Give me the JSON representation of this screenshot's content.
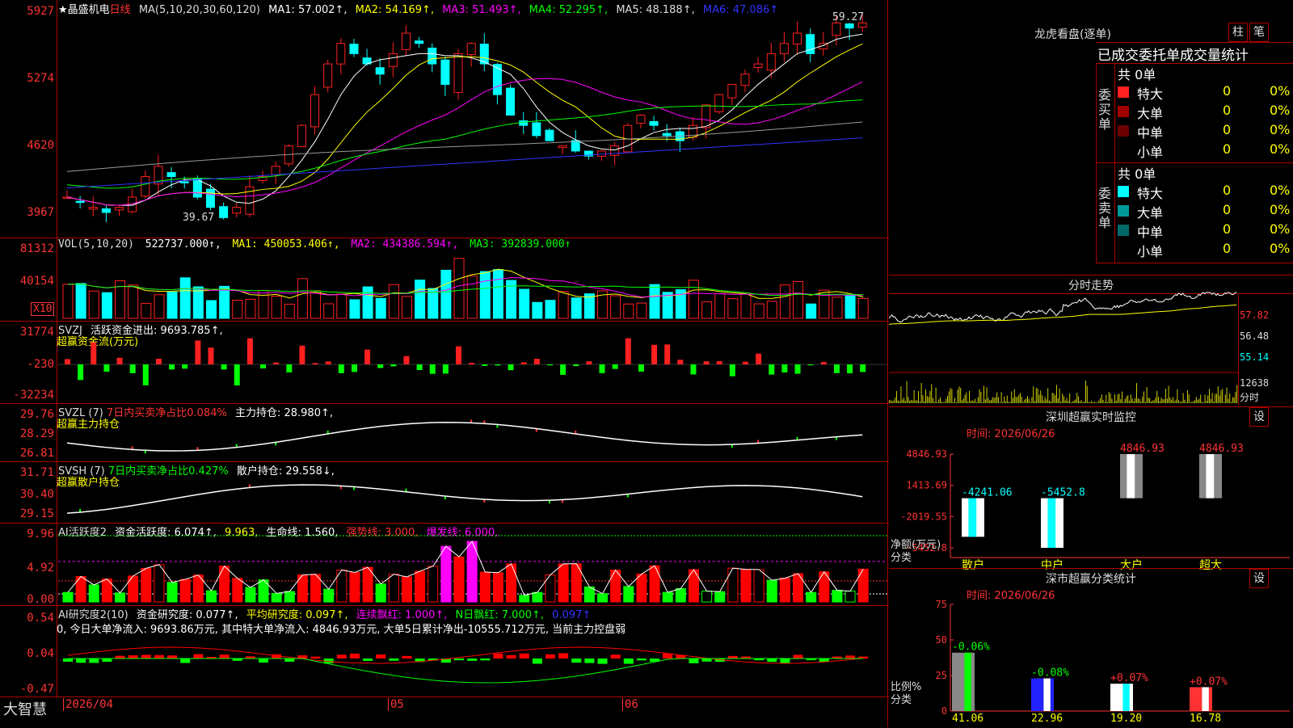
{
  "panels": {
    "price": {
      "header": [
        "★晶盛机电",
        "日线",
        "MA(5,10,20,30,60,120)",
        "MA1: 57.002↑,",
        "MA2: 54.169↑,",
        "MA3: 51.493↑,",
        "MA4: 52.295↑,",
        "MA5: 48.188↑,",
        "MA6: 47.086↑"
      ],
      "axis": [
        "5927",
        "5274",
        "4620",
        "3967"
      ],
      "high_label": "59.27",
      "low_label": "39.67"
    },
    "vol": {
      "header": [
        "VOL(5,10,20)",
        "522737.000↑,",
        "MA1: 450053.406↑,",
        "MA2: 434386.594↑,",
        "MA3: 392839.000↑"
      ],
      "axis": [
        "81312",
        "40154"
      ],
      "unit": "X10"
    },
    "svzj": {
      "header": [
        "SVZJ",
        "活跃资金进出: 9693.785↑,"
      ],
      "sub": "超赢资金流(万元)",
      "axis": [
        "31774",
        "-230",
        "-32234"
      ]
    },
    "svzl": {
      "header": [
        "SVZL (7)",
        "7日内买卖净占比0.084%",
        "主力持仓: 28.980↑,"
      ],
      "sub": "超赢主力持仓",
      "axis": [
        "29.76",
        "28.29",
        "26.81"
      ]
    },
    "svsh": {
      "header": [
        "SVSH (7)",
        "7日内买卖净占比0.427%",
        "散户持仓: 29.558↓,"
      ],
      "sub": "超赢散户持仓",
      "axis": [
        "31.71",
        "30.40",
        "29.15"
      ]
    },
    "ai1": {
      "header": [
        "AI活跃度2",
        "资金活跃度: 6.074↑,",
        "9.963,",
        "生命线: 1.560,",
        "强势线: 3.000,",
        "爆发线: 6.000,"
      ],
      "axis": [
        "9.96",
        "4.92",
        "0.00"
      ]
    },
    "ai2": {
      "header": [
        "AI研究度2(10)",
        "资金研究度: 0.077↑,",
        "平均研究度: 0.097↑,",
        "连续飘红: 1.000↑,",
        "N日飘红: 7.000↑,",
        "0.097↑"
      ],
      "line2": "0, 今日大单净流入: 9693.86万元, 其中特大单净流入: 4846.93万元, 大单5日累计净出-10555.712万元, 当前主力控盘弱",
      "axis": [
        "0.54",
        "0.04",
        "-0.47"
      ]
    }
  },
  "footer": {
    "brand": "大智慧",
    "dates": [
      "2026/04",
      "05",
      "06"
    ]
  },
  "right": {
    "dragon_title": "龙虎看盘(逐单)",
    "btn_zhu": "柱",
    "btn_bi": "笔",
    "stat_title": "已成交委托单成交量统计",
    "buy": {
      "label": "委买单",
      "total": "共 0单",
      "rows": [
        {
          "name": "特大",
          "count": "0",
          "pct": "0%",
          "color": "#ff2020"
        },
        {
          "name": "大单",
          "count": "0",
          "pct": "0%",
          "color": "#a00000"
        },
        {
          "name": "中单",
          "count": "0",
          "pct": "0%",
          "color": "#6a0000"
        },
        {
          "name": "小单",
          "count": "0",
          "pct": "0%",
          "color": "#000000"
        }
      ]
    },
    "sell": {
      "label": "委卖单",
      "total": "共 0单",
      "rows": [
        {
          "name": "特大",
          "count": "0",
          "pct": "0%",
          "color": "#00ffff"
        },
        {
          "name": "大单",
          "count": "0",
          "pct": "0%",
          "color": "#009999"
        },
        {
          "name": "中单",
          "count": "0",
          "pct": "0%",
          "color": "#006a6a"
        },
        {
          "name": "小单",
          "count": "0",
          "pct": "0%",
          "color": "#000000"
        }
      ]
    },
    "intraday": {
      "title": "分时走势",
      "axis": [
        "57.82",
        "56.48",
        "55.14"
      ],
      "vol_axis": "12638",
      "vol_unit": "分时"
    },
    "sz_monitor": {
      "title": "深圳超赢实时监控",
      "btn": "设",
      "time": "时间: 2026/06/26",
      "axis": [
        "4846.93",
        "1413.69",
        "-2019.55",
        "-5452.8"
      ],
      "ylabel": "净额(万元)",
      "xlabel": "分类",
      "cats": [
        "散户",
        "中户",
        "大户",
        "超大"
      ],
      "values": [
        -4241.06,
        -5452.8,
        4846.93,
        4846.93
      ],
      "labels": [
        "-4241.06",
        "-5452.8",
        "4846.93",
        "4846.93"
      ]
    },
    "sz_class": {
      "title": "深市超赢分类统计",
      "btn": "设",
      "time": "时间: 2026/06/26",
      "axis": [
        "75",
        "50",
        "25",
        "0"
      ],
      "ylabel": "比例%",
      "xlabel": "分类",
      "cats": [
        "散户",
        "中户",
        "大户",
        "超大"
      ],
      "values": [
        41.06,
        22.96,
        19.2,
        16.78
      ],
      "labels": [
        "41.06",
        "22.96",
        "19.20",
        "16.78"
      ],
      "changes": [
        "-0.06%",
        "-0.08%",
        "+0.07%",
        "+0.07%"
      ]
    }
  },
  "colors": {
    "up": "#ff2020",
    "down": "#00ffff",
    "frame": "#aa0000"
  }
}
